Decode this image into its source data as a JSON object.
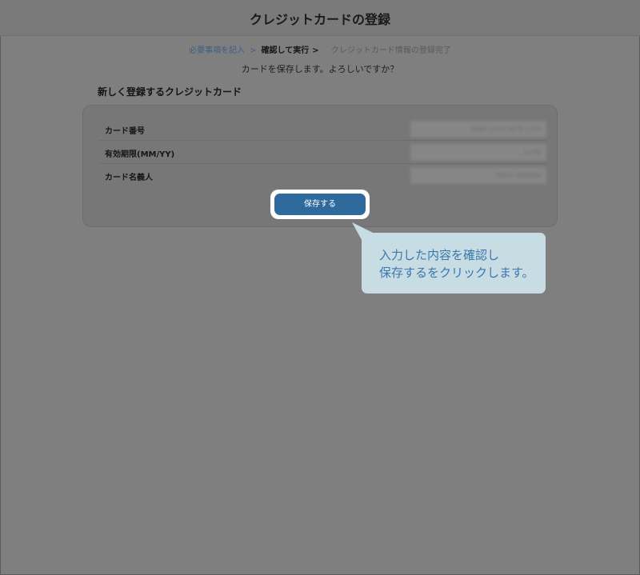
{
  "header": {
    "title": "クレジットカードの登録"
  },
  "steps": [
    {
      "label": "必要事項を記入",
      "separator": ">"
    },
    {
      "label": "確認して実行",
      "separator": ">"
    },
    {
      "label": "クレジットカード情報の登録完了"
    }
  ],
  "confirm_message": "カードを保存します。よろしいですか？",
  "section_title": "新しく登録するクレジットカード",
  "card_info": {
    "rows": [
      {
        "label": "カード番号",
        "value": "4980 1234 5678 1234"
      },
      {
        "label": "有効期限(MM/YY)",
        "value": "12/30"
      },
      {
        "label": "カード名義人",
        "value": "TARO YAMADA"
      }
    ]
  },
  "save_button_label": "保存する",
  "callout": {
    "lines": [
      "入力した内容を確認し",
      "保存するをクリックします。"
    ]
  }
}
